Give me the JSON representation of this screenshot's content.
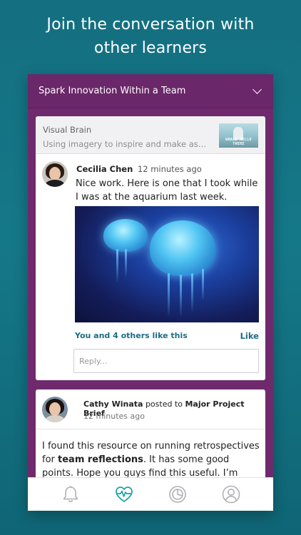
{
  "headline": {
    "line1": "Join the conversation with",
    "line2": "other learners"
  },
  "topbar": {
    "title": "Spark Innovation Within a Team"
  },
  "resource": {
    "title": "Visual Brain",
    "description": "Using imagery to inspire and make associa...",
    "thumb_caption": "WHALE HELLO THERE"
  },
  "comment1": {
    "author": "Cecilia Chen",
    "time": "12 minutes ago",
    "text": "Nice work. Here is one that I took while I was at the aquarium last week.",
    "likes_text": "You and 4 others like this",
    "like_label": "Like",
    "reply_placeholder": "Reply..."
  },
  "comment2": {
    "author": "Cathy Winata",
    "posted_to": "posted to",
    "target": "Major Project Brief",
    "time": "12 minutes ago",
    "text_before": "I found this resource on running retrospectives for ",
    "text_bold": "team reflections",
    "text_after": ". It has some good points. Hope you guys find this useful. I’m planning to use this"
  },
  "tabs": [
    {
      "icon": "bell-icon"
    },
    {
      "icon": "activity-heart-icon",
      "active": true
    },
    {
      "icon": "clock-pie-icon"
    },
    {
      "icon": "profile-icon"
    }
  ],
  "colors": {
    "background": "#157888",
    "header_purple": "#6a2769",
    "accent_teal": "#1aa3a8",
    "link_blue": "#1c6c86"
  }
}
